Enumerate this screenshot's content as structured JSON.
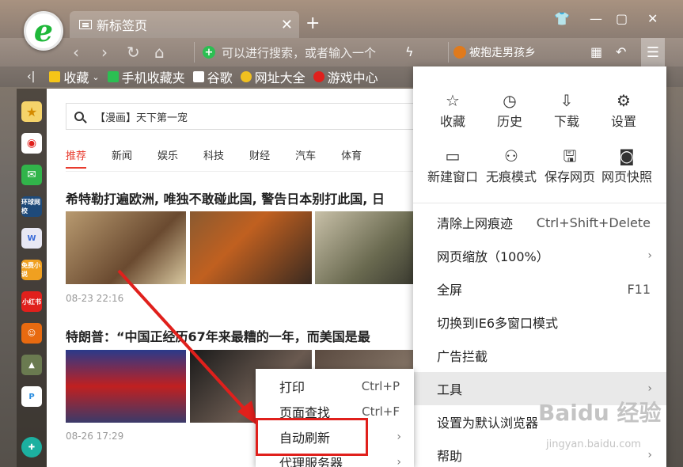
{
  "tab": {
    "title": "新标签页"
  },
  "address": {
    "placeholder": "可以进行搜索，或者输入一个"
  },
  "search_bar": {
    "text": "被抱走男孩乡"
  },
  "bookmarks": [
    "收藏",
    "手机收藏夹",
    "谷歌",
    "网址大全",
    "游戏中心"
  ],
  "sidebar": [
    "环球网校",
    "免费小说",
    "小红书"
  ],
  "page": {
    "search_text": "【漫画】天下第一宠",
    "categories": [
      "推荐",
      "新闻",
      "娱乐",
      "科技",
      "财经",
      "汽车",
      "体育"
    ],
    "articles": [
      {
        "headline": "希特勒打遍欧洲, 唯独不敢碰此国, 警告日本别打此国, 日",
        "time": "08-23 22:16"
      },
      {
        "headline": "特朗普：“中国正经历67年来最糟的一年，而美国是最",
        "time": "08-26 17:29"
      }
    ]
  },
  "menu": {
    "grid": [
      {
        "label": "收藏",
        "icon": "star-icon"
      },
      {
        "label": "历史",
        "icon": "clock-icon"
      },
      {
        "label": "下载",
        "icon": "download-icon"
      },
      {
        "label": "设置",
        "icon": "gear-icon"
      },
      {
        "label": "新建窗口",
        "icon": "window-icon"
      },
      {
        "label": "无痕模式",
        "icon": "incognito-icon"
      },
      {
        "label": "保存网页",
        "icon": "save-icon"
      },
      {
        "label": "网页快照",
        "icon": "camera-icon"
      }
    ],
    "items": [
      {
        "label": "清除上网痕迹",
        "shortcut": "Ctrl+Shift+Delete"
      },
      {
        "label": "网页缩放（100%）",
        "arrow": "›"
      },
      {
        "label": "全屏",
        "shortcut": "F11"
      },
      {
        "label": "切换到IE6多窗口模式"
      },
      {
        "label": "广告拦截"
      },
      {
        "label": "工具",
        "arrow": "›"
      },
      {
        "label": "设置为默认浏览器"
      },
      {
        "label": "帮助",
        "arrow": "›"
      }
    ]
  },
  "submenu": {
    "items": [
      {
        "label": "打印",
        "shortcut": "Ctrl+P"
      },
      {
        "label": "页面查找",
        "shortcut": "Ctrl+F"
      },
      {
        "label": "自动刷新",
        "arrow": "›"
      },
      {
        "label": "代理服务器",
        "arrow": "›"
      }
    ]
  },
  "watermark": {
    "text": "Baidu 经验",
    "sub": "jingyan.baidu.com"
  },
  "colors": {
    "highlight": "#e0201c",
    "accent": "#e83b2e"
  }
}
